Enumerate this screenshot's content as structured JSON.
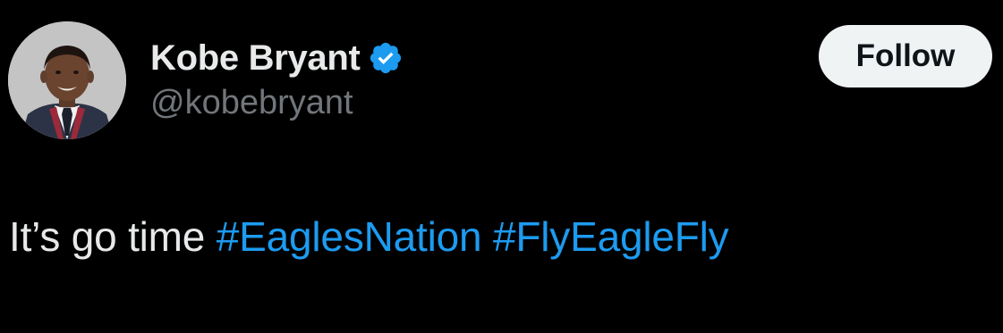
{
  "author": {
    "display_name": "Kobe Bryant",
    "handle": "@kobebryant",
    "verified": true
  },
  "follow_button": {
    "label": "Follow"
  },
  "tweet": {
    "text": "It’s go time",
    "hashtags": [
      "#EaglesNation",
      "#FlyEagleFly"
    ]
  },
  "colors": {
    "background": "#000000",
    "primary_text": "#e7e9ea",
    "secondary_text": "#71767b",
    "link": "#1d9bf0",
    "verified_badge": "#1d9bf0",
    "button_bg": "#eff3f4",
    "button_text": "#0f1419"
  },
  "icons": {
    "avatar": "profile-photo",
    "badge": "verified-checkmark-icon"
  }
}
